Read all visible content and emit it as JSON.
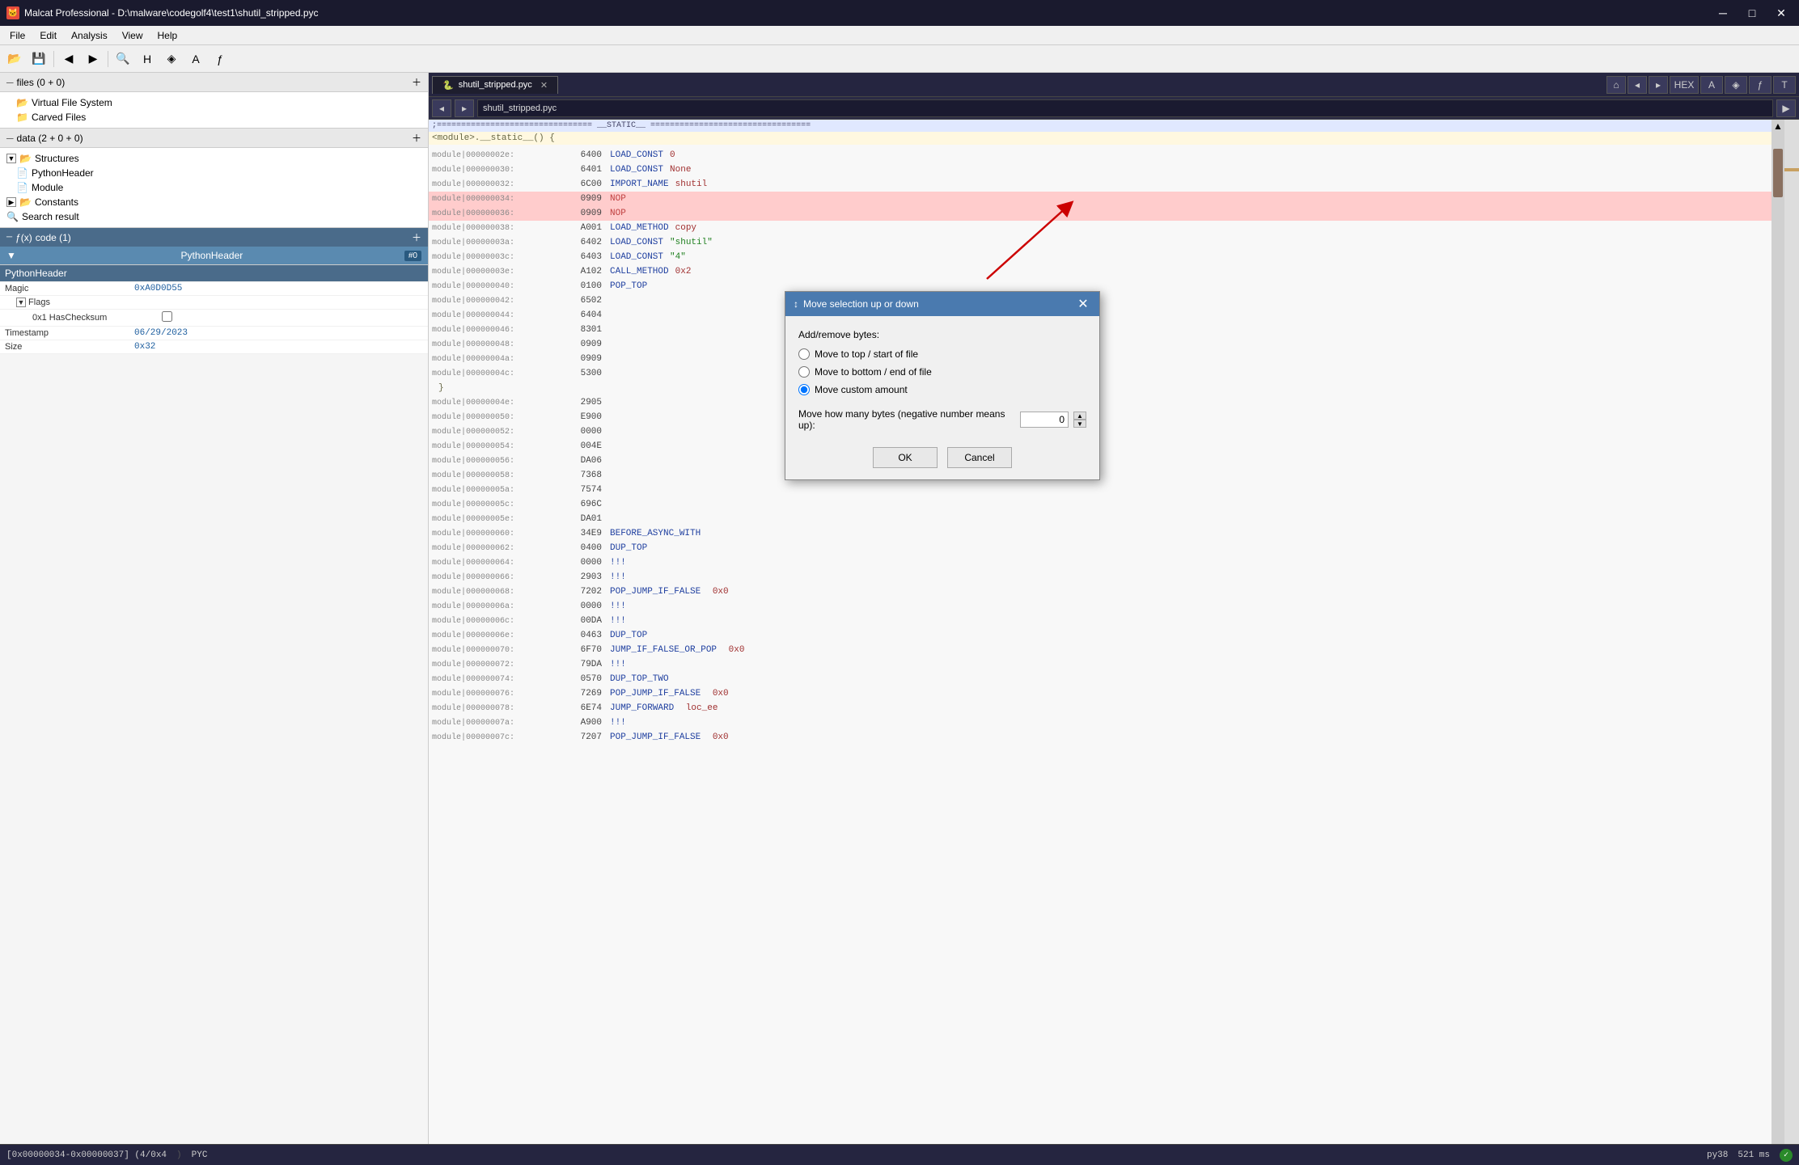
{
  "window": {
    "title": "Malcat Professional - D:\\malware\\codegolf4\\test1\\shutil_stripped.pyc",
    "icon": "🐱"
  },
  "menu": {
    "items": [
      "File",
      "Edit",
      "Analysis",
      "View",
      "Help"
    ]
  },
  "left_panel": {
    "files_header": "files (0 + 0)",
    "tree_items": [
      {
        "label": "Virtual File System",
        "level": 1,
        "icon": "📂"
      },
      {
        "label": "Carved Files",
        "level": 1,
        "icon": "📁"
      }
    ],
    "data_header": "data (2 + 0 + 0)",
    "data_tree": [
      {
        "label": "Structures",
        "level": 0,
        "icon": "📂"
      },
      {
        "label": "PythonHeader",
        "level": 1,
        "icon": "📄"
      },
      {
        "label": "Module",
        "level": 1,
        "icon": "📄"
      },
      {
        "label": "Constants",
        "level": 0,
        "icon": "📂"
      },
      {
        "label": "Search result",
        "level": 0,
        "icon": "🔍"
      }
    ],
    "code_header": "code (1)",
    "code_items": [
      {
        "label": "PythonHeader",
        "badge": "#0"
      }
    ],
    "properties": {
      "selected": "PythonHeader",
      "fields": [
        {
          "name": "Magic",
          "value": "0xA0D0D55"
        },
        {
          "name": "Flags",
          "value": "",
          "is_group": true
        },
        {
          "name": "0x1 HasChecksum",
          "value": "",
          "is_flag": true
        },
        {
          "name": "Timestamp",
          "value": "06/29/2023"
        },
        {
          "name": "Size",
          "value": "0x32"
        }
      ]
    }
  },
  "tab_bar": {
    "active_tab": "shutil_stripped.pyc",
    "icon": "🐍"
  },
  "code_view": {
    "addr_bar_value": "shutil_stripped.pyc",
    "static_header": ";================================ __STATIC__ =================================",
    "func_header": "<module>.__static__() {",
    "closing_brace": "}",
    "lines": [
      {
        "addr": "module|00000002e:",
        "offset": "6400",
        "opcode": "",
        "instr": "LOAD_CONST",
        "arg": "0",
        "highlight": false
      },
      {
        "addr": "module|00000030:",
        "offset": "6401",
        "opcode": "",
        "instr": "LOAD_CONST",
        "arg": "None",
        "highlight": false
      },
      {
        "addr": "module|00000032:",
        "offset": "6C00",
        "opcode": "",
        "instr": "IMPORT_NAME",
        "arg": "shutil",
        "highlight": false
      },
      {
        "addr": "module|00000034:",
        "offset": "0909",
        "opcode": "",
        "instr": "NOP",
        "arg": "",
        "highlight": true
      },
      {
        "addr": "module|00000036:",
        "offset": "0909",
        "opcode": "",
        "instr": "NOP",
        "arg": "",
        "highlight": true
      },
      {
        "addr": "module|00000038:",
        "offset": "A001",
        "opcode": "",
        "instr": "LOAD_METHOD",
        "arg": "copy",
        "highlight": false
      },
      {
        "addr": "module|0000003a:",
        "offset": "6402",
        "opcode": "",
        "instr": "LOAD_CONST",
        "arg": "\"shutil\"",
        "highlight": false
      },
      {
        "addr": "module|0000003c:",
        "offset": "6403",
        "opcode": "",
        "instr": "LOAD_CONST",
        "arg": "\"4\"",
        "highlight": false
      },
      {
        "addr": "module|0000003e:",
        "offset": "A102",
        "opcode": "",
        "instr": "CALL_METHOD",
        "arg": "0x2",
        "highlight": false
      },
      {
        "addr": "module|00000040:",
        "offset": "0100",
        "opcode": "",
        "instr": "POP_TOP",
        "arg": "",
        "highlight": false
      },
      {
        "addr": "module|00000042:",
        "offset": "6502",
        "opcode": "",
        "instr": "",
        "arg": "",
        "highlight": false
      },
      {
        "addr": "module|00000044:",
        "offset": "6404",
        "opcode": "",
        "instr": "",
        "arg": "",
        "highlight": false
      },
      {
        "addr": "module|00000046:",
        "offset": "8301",
        "opcode": "",
        "instr": "",
        "arg": "",
        "highlight": false
      },
      {
        "addr": "module|00000048:",
        "offset": "0909",
        "opcode": "",
        "instr": "",
        "arg": "",
        "highlight": false
      },
      {
        "addr": "module|0000004a:",
        "offset": "0909",
        "opcode": "",
        "instr": "",
        "arg": "",
        "highlight": false
      },
      {
        "addr": "module|0000004c:",
        "offset": "5300",
        "opcode": "",
        "instr": "",
        "arg": "",
        "highlight": false
      },
      {
        "addr": "module|0000004e:",
        "offset": "2905",
        "opcode": "",
        "instr": "",
        "arg": "",
        "highlight": false
      },
      {
        "addr": "module|00000050:",
        "offset": "E900",
        "opcode": "",
        "instr": "",
        "arg": "",
        "highlight": false
      },
      {
        "addr": "module|00000052:",
        "offset": "0000",
        "opcode": "",
        "instr": "",
        "arg": "",
        "highlight": false
      },
      {
        "addr": "module|00000054:",
        "offset": "004E",
        "opcode": "",
        "instr": "",
        "arg": "",
        "highlight": false
      },
      {
        "addr": "module|00000056:",
        "offset": "DA06",
        "opcode": "",
        "instr": "",
        "arg": "",
        "highlight": false
      },
      {
        "addr": "module|00000058:",
        "offset": "7368",
        "opcode": "",
        "instr": "",
        "arg": "",
        "highlight": false
      },
      {
        "addr": "module|0000005a:",
        "offset": "7574",
        "opcode": "",
        "instr": "",
        "arg": "",
        "highlight": false
      },
      {
        "addr": "module|0000005c:",
        "offset": "696C",
        "opcode": "",
        "instr": "",
        "arg": "",
        "highlight": false
      },
      {
        "addr": "module|0000005e:",
        "offset": "DA01",
        "opcode": "",
        "instr": "",
        "arg": "",
        "highlight": false
      },
      {
        "addr": "module|00000060:",
        "offset": "34E9",
        "opcode": "",
        "instr": "BEFORE_ASYNC_WITH",
        "arg": "",
        "highlight": false
      },
      {
        "addr": "module|00000062:",
        "offset": "0400",
        "opcode": "",
        "instr": "DUP_TOP",
        "arg": "",
        "highlight": false
      },
      {
        "addr": "module|00000064:",
        "offset": "0000",
        "opcode": "",
        "instr": "!!!",
        "arg": "",
        "highlight": false
      },
      {
        "addr": "module|00000066:",
        "offset": "2903",
        "opcode": "",
        "instr": "!!!",
        "arg": "",
        "highlight": false
      },
      {
        "addr": "module|00000068:",
        "offset": "7202",
        "opcode": "",
        "instr": "POP_JUMP_IF_FALSE",
        "arg": "0x0",
        "highlight": false
      },
      {
        "addr": "module|0000006a:",
        "offset": "0000",
        "opcode": "",
        "instr": "!!!",
        "arg": "",
        "highlight": false
      },
      {
        "addr": "module|0000006c:",
        "offset": "00DA",
        "opcode": "",
        "instr": "!!!",
        "arg": "",
        "highlight": false
      },
      {
        "addr": "module|0000006e:",
        "offset": "0463",
        "opcode": "",
        "instr": "DUP_TOP",
        "arg": "",
        "highlight": false
      },
      {
        "addr": "module|00000070:",
        "offset": "6F70",
        "opcode": "",
        "instr": "JUMP_IF_FALSE_OR_POP",
        "arg": "0x0",
        "highlight": false
      },
      {
        "addr": "module|00000072:",
        "offset": "79DA",
        "opcode": "",
        "instr": "!!!",
        "arg": "",
        "highlight": false
      },
      {
        "addr": "module|00000074:",
        "offset": "0570",
        "opcode": "",
        "instr": "DUP_TOP_TWO",
        "arg": "",
        "highlight": false
      },
      {
        "addr": "module|00000076:",
        "offset": "7269",
        "opcode": "",
        "instr": "POP_JUMP_IF_FALSE",
        "arg": "0x0",
        "highlight": false
      },
      {
        "addr": "module|00000078:",
        "offset": "6E74",
        "opcode": "",
        "instr": "JUMP_FORWARD",
        "arg": "loc_ee",
        "highlight": false
      },
      {
        "addr": "module|0000007a:",
        "offset": "A900",
        "opcode": "",
        "instr": "!!!",
        "arg": "",
        "highlight": false
      },
      {
        "addr": "module|0000007c:",
        "offset": "7207",
        "opcode": "",
        "instr": "POP_JUMP_IF_FALSE",
        "arg": "0x0",
        "highlight": false
      }
    ]
  },
  "dialog": {
    "title": "Move selection up or down",
    "title_icon": "↕",
    "section_label": "Add/remove bytes:",
    "options": [
      {
        "id": "opt1",
        "label": "Move to top / start of file",
        "checked": false
      },
      {
        "id": "opt2",
        "label": "Move to bottom / end of file",
        "checked": false
      },
      {
        "id": "opt3",
        "label": "Move custom amount",
        "checked": true
      }
    ],
    "amount_label": "Move how many bytes (negative number means up):",
    "amount_value": "0",
    "ok_label": "OK",
    "cancel_label": "Cancel"
  },
  "status_bar": {
    "position": "[0x00000034-0x00000037] (4/0x4",
    "format": "PYC",
    "python": "py38",
    "time": "521 ms"
  }
}
